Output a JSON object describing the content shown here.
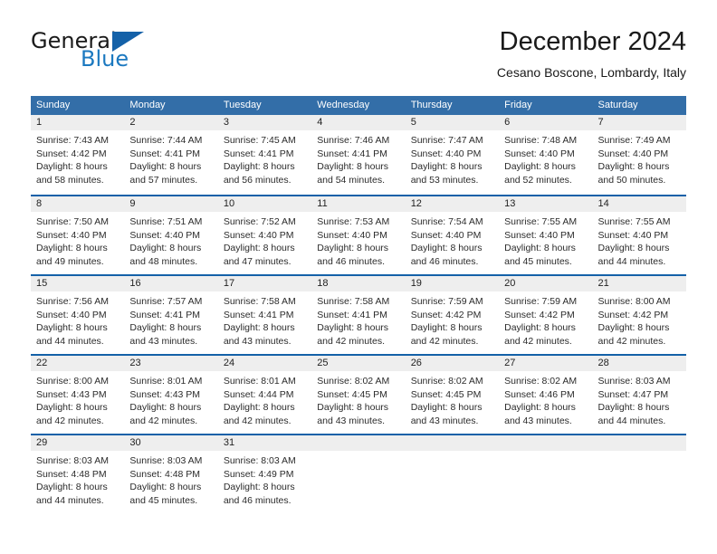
{
  "brand": {
    "name_part1": "General",
    "name_part2": "Blue",
    "triangle_color": "#1461a8",
    "blue_text_color": "#1c79c0"
  },
  "header": {
    "title": "December 2024",
    "subtitle": "Cesano Boscone, Lombardy, Italy"
  },
  "theme": {
    "header_row_bg": "#336ea8",
    "week_divider": "#1461a8",
    "daynum_band_bg": "#eeeeee",
    "header_text": "#ffffff"
  },
  "calendar": {
    "weekday_headers": [
      "Sunday",
      "Monday",
      "Tuesday",
      "Wednesday",
      "Thursday",
      "Friday",
      "Saturday"
    ],
    "weeks": [
      [
        {
          "day": "1",
          "sunrise": "Sunrise: 7:43 AM",
          "sunset": "Sunset: 4:42 PM",
          "daylight1": "Daylight: 8 hours",
          "daylight2": "and 58 minutes."
        },
        {
          "day": "2",
          "sunrise": "Sunrise: 7:44 AM",
          "sunset": "Sunset: 4:41 PM",
          "daylight1": "Daylight: 8 hours",
          "daylight2": "and 57 minutes."
        },
        {
          "day": "3",
          "sunrise": "Sunrise: 7:45 AM",
          "sunset": "Sunset: 4:41 PM",
          "daylight1": "Daylight: 8 hours",
          "daylight2": "and 56 minutes."
        },
        {
          "day": "4",
          "sunrise": "Sunrise: 7:46 AM",
          "sunset": "Sunset: 4:41 PM",
          "daylight1": "Daylight: 8 hours",
          "daylight2": "and 54 minutes."
        },
        {
          "day": "5",
          "sunrise": "Sunrise: 7:47 AM",
          "sunset": "Sunset: 4:40 PM",
          "daylight1": "Daylight: 8 hours",
          "daylight2": "and 53 minutes."
        },
        {
          "day": "6",
          "sunrise": "Sunrise: 7:48 AM",
          "sunset": "Sunset: 4:40 PM",
          "daylight1": "Daylight: 8 hours",
          "daylight2": "and 52 minutes."
        },
        {
          "day": "7",
          "sunrise": "Sunrise: 7:49 AM",
          "sunset": "Sunset: 4:40 PM",
          "daylight1": "Daylight: 8 hours",
          "daylight2": "and 50 minutes."
        }
      ],
      [
        {
          "day": "8",
          "sunrise": "Sunrise: 7:50 AM",
          "sunset": "Sunset: 4:40 PM",
          "daylight1": "Daylight: 8 hours",
          "daylight2": "and 49 minutes."
        },
        {
          "day": "9",
          "sunrise": "Sunrise: 7:51 AM",
          "sunset": "Sunset: 4:40 PM",
          "daylight1": "Daylight: 8 hours",
          "daylight2": "and 48 minutes."
        },
        {
          "day": "10",
          "sunrise": "Sunrise: 7:52 AM",
          "sunset": "Sunset: 4:40 PM",
          "daylight1": "Daylight: 8 hours",
          "daylight2": "and 47 minutes."
        },
        {
          "day": "11",
          "sunrise": "Sunrise: 7:53 AM",
          "sunset": "Sunset: 4:40 PM",
          "daylight1": "Daylight: 8 hours",
          "daylight2": "and 46 minutes."
        },
        {
          "day": "12",
          "sunrise": "Sunrise: 7:54 AM",
          "sunset": "Sunset: 4:40 PM",
          "daylight1": "Daylight: 8 hours",
          "daylight2": "and 46 minutes."
        },
        {
          "day": "13",
          "sunrise": "Sunrise: 7:55 AM",
          "sunset": "Sunset: 4:40 PM",
          "daylight1": "Daylight: 8 hours",
          "daylight2": "and 45 minutes."
        },
        {
          "day": "14",
          "sunrise": "Sunrise: 7:55 AM",
          "sunset": "Sunset: 4:40 PM",
          "daylight1": "Daylight: 8 hours",
          "daylight2": "and 44 minutes."
        }
      ],
      [
        {
          "day": "15",
          "sunrise": "Sunrise: 7:56 AM",
          "sunset": "Sunset: 4:40 PM",
          "daylight1": "Daylight: 8 hours",
          "daylight2": "and 44 minutes."
        },
        {
          "day": "16",
          "sunrise": "Sunrise: 7:57 AM",
          "sunset": "Sunset: 4:41 PM",
          "daylight1": "Daylight: 8 hours",
          "daylight2": "and 43 minutes."
        },
        {
          "day": "17",
          "sunrise": "Sunrise: 7:58 AM",
          "sunset": "Sunset: 4:41 PM",
          "daylight1": "Daylight: 8 hours",
          "daylight2": "and 43 minutes."
        },
        {
          "day": "18",
          "sunrise": "Sunrise: 7:58 AM",
          "sunset": "Sunset: 4:41 PM",
          "daylight1": "Daylight: 8 hours",
          "daylight2": "and 42 minutes."
        },
        {
          "day": "19",
          "sunrise": "Sunrise: 7:59 AM",
          "sunset": "Sunset: 4:42 PM",
          "daylight1": "Daylight: 8 hours",
          "daylight2": "and 42 minutes."
        },
        {
          "day": "20",
          "sunrise": "Sunrise: 7:59 AM",
          "sunset": "Sunset: 4:42 PM",
          "daylight1": "Daylight: 8 hours",
          "daylight2": "and 42 minutes."
        },
        {
          "day": "21",
          "sunrise": "Sunrise: 8:00 AM",
          "sunset": "Sunset: 4:42 PM",
          "daylight1": "Daylight: 8 hours",
          "daylight2": "and 42 minutes."
        }
      ],
      [
        {
          "day": "22",
          "sunrise": "Sunrise: 8:00 AM",
          "sunset": "Sunset: 4:43 PM",
          "daylight1": "Daylight: 8 hours",
          "daylight2": "and 42 minutes."
        },
        {
          "day": "23",
          "sunrise": "Sunrise: 8:01 AM",
          "sunset": "Sunset: 4:43 PM",
          "daylight1": "Daylight: 8 hours",
          "daylight2": "and 42 minutes."
        },
        {
          "day": "24",
          "sunrise": "Sunrise: 8:01 AM",
          "sunset": "Sunset: 4:44 PM",
          "daylight1": "Daylight: 8 hours",
          "daylight2": "and 42 minutes."
        },
        {
          "day": "25",
          "sunrise": "Sunrise: 8:02 AM",
          "sunset": "Sunset: 4:45 PM",
          "daylight1": "Daylight: 8 hours",
          "daylight2": "and 43 minutes."
        },
        {
          "day": "26",
          "sunrise": "Sunrise: 8:02 AM",
          "sunset": "Sunset: 4:45 PM",
          "daylight1": "Daylight: 8 hours",
          "daylight2": "and 43 minutes."
        },
        {
          "day": "27",
          "sunrise": "Sunrise: 8:02 AM",
          "sunset": "Sunset: 4:46 PM",
          "daylight1": "Daylight: 8 hours",
          "daylight2": "and 43 minutes."
        },
        {
          "day": "28",
          "sunrise": "Sunrise: 8:03 AM",
          "sunset": "Sunset: 4:47 PM",
          "daylight1": "Daylight: 8 hours",
          "daylight2": "and 44 minutes."
        }
      ],
      [
        {
          "day": "29",
          "sunrise": "Sunrise: 8:03 AM",
          "sunset": "Sunset: 4:48 PM",
          "daylight1": "Daylight: 8 hours",
          "daylight2": "and 44 minutes."
        },
        {
          "day": "30",
          "sunrise": "Sunrise: 8:03 AM",
          "sunset": "Sunset: 4:48 PM",
          "daylight1": "Daylight: 8 hours",
          "daylight2": "and 45 minutes."
        },
        {
          "day": "31",
          "sunrise": "Sunrise: 8:03 AM",
          "sunset": "Sunset: 4:49 PM",
          "daylight1": "Daylight: 8 hours",
          "daylight2": "and 46 minutes."
        },
        {
          "day": "",
          "sunrise": "",
          "sunset": "",
          "daylight1": "",
          "daylight2": ""
        },
        {
          "day": "",
          "sunrise": "",
          "sunset": "",
          "daylight1": "",
          "daylight2": ""
        },
        {
          "day": "",
          "sunrise": "",
          "sunset": "",
          "daylight1": "",
          "daylight2": ""
        },
        {
          "day": "",
          "sunrise": "",
          "sunset": "",
          "daylight1": "",
          "daylight2": ""
        }
      ]
    ]
  }
}
